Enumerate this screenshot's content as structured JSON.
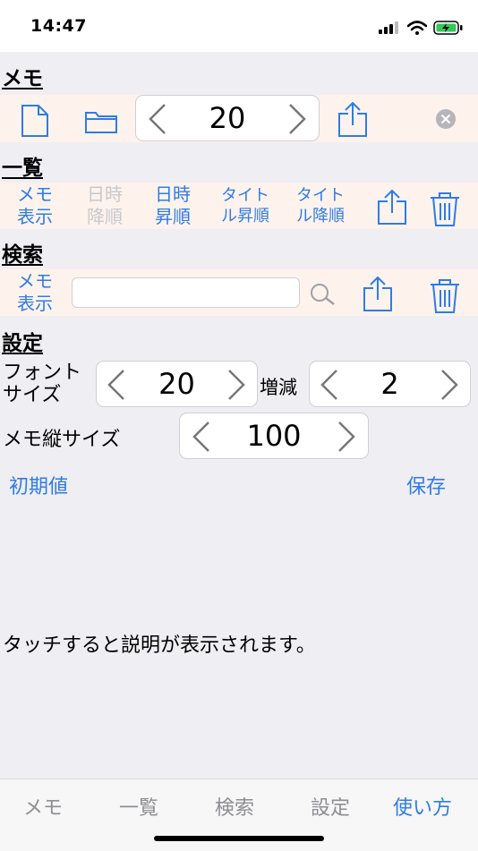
{
  "status": {
    "time": "14:47"
  },
  "memo": {
    "title": "メモ",
    "value": "20"
  },
  "list": {
    "title": "一覧",
    "memo_show": [
      "メモ",
      "表示"
    ],
    "date_desc": [
      "日時",
      "降順"
    ],
    "date_asc": [
      "日時",
      "昇順"
    ],
    "title_asc": [
      "タイト",
      "ル昇順"
    ],
    "title_desc": [
      "タイト",
      "ル降順"
    ]
  },
  "search": {
    "title": "検索",
    "memo_show": [
      "メモ",
      "表示"
    ],
    "input_value": ""
  },
  "settings": {
    "title": "設定",
    "font_size_label": [
      "フォント",
      "サイズ"
    ],
    "font_size_value": "20",
    "step_label": "増減",
    "step_value": "2",
    "memo_height_label": "メモ縦サイズ",
    "memo_height_value": "100",
    "reset_label": "初期値",
    "save_label": "保存"
  },
  "hint_text": "タッチすると説明が表示されます。",
  "tabs": [
    {
      "label": "メモ",
      "active": false
    },
    {
      "label": "一覧",
      "active": false
    },
    {
      "label": "検索",
      "active": false
    },
    {
      "label": "設定",
      "active": false
    },
    {
      "label": "使い方",
      "active": true
    }
  ],
  "colors": {
    "accent": "#2f7ce6",
    "band": "#fdf3ec",
    "background": "#efeef3"
  }
}
